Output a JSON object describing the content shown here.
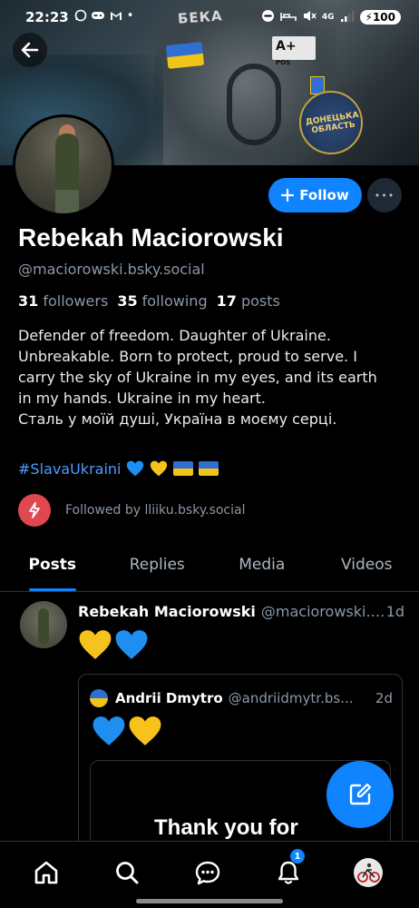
{
  "status_bar": {
    "time": "22:23",
    "left_icons": [
      "whatsapp-icon",
      "game-controller-icon",
      "gmail-icon",
      "dot"
    ],
    "right_icons": [
      "do-not-disturb-icon",
      "sleep-icon",
      "mute-icon",
      "4g-icon",
      "signal-icon"
    ],
    "network": "4G",
    "battery": "100"
  },
  "banner": {
    "patch_text": "БЕКА",
    "badge_text": "A+",
    "badge_sub": "POS",
    "round_patch_text": "ДОНЕЦЬКА ОБЛАСТЬ"
  },
  "profile": {
    "name": "Rebekah Maciorowski",
    "handle": "@maciorowski.bsky.social",
    "followers_count": "31",
    "followers_label": "followers",
    "following_count": "35",
    "following_label": "following",
    "posts_count": "17",
    "posts_label": "posts",
    "bio_lines": [
      "Defender of freedom. Daughter of Ukraine.",
      "Unbreakable. Born to protect, proud to serve. I",
      "carry the sky of Ukraine in my eyes, and its earth",
      "in my hands. Ukraine in my heart.",
      "Сталь у моїй душі, Україна в моєму серці."
    ],
    "hashtag": "#SlavaUkraini",
    "hashtag_emojis": [
      "blue-heart",
      "yellow-heart",
      "ukraine-flag",
      "ukraine-flag"
    ],
    "followed_by": "Followed by lliiku.bsky.social"
  },
  "actions": {
    "follow_label": "Follow",
    "more_label": "•••"
  },
  "tabs": [
    {
      "label": "Posts",
      "active": true
    },
    {
      "label": "Replies",
      "active": false
    },
    {
      "label": "Media",
      "active": false
    },
    {
      "label": "Videos",
      "active": false
    }
  ],
  "post": {
    "author": "Rebekah Maciorowski",
    "handle": "@maciorowski.b...",
    "time": "1d",
    "emojis": [
      "yellow-heart",
      "blue-heart"
    ],
    "quote": {
      "author": "Andrii Dmytro",
      "handle": "@andriidmytr.bs...",
      "time": "2d",
      "emojis": [
        "blue-heart",
        "yellow-heart"
      ],
      "image_text": "Thank you for"
    }
  },
  "bottom_nav": {
    "items": [
      "home-icon",
      "search-icon",
      "chat-icon",
      "bell-icon",
      "avatar"
    ],
    "notification_count": "1"
  },
  "colors": {
    "accent": "#1083fe",
    "muted": "#8b98a5",
    "ukraine_blue": "#2f6fd1",
    "ukraine_yellow": "#f0c419",
    "followed_badge": "#e0484f"
  }
}
